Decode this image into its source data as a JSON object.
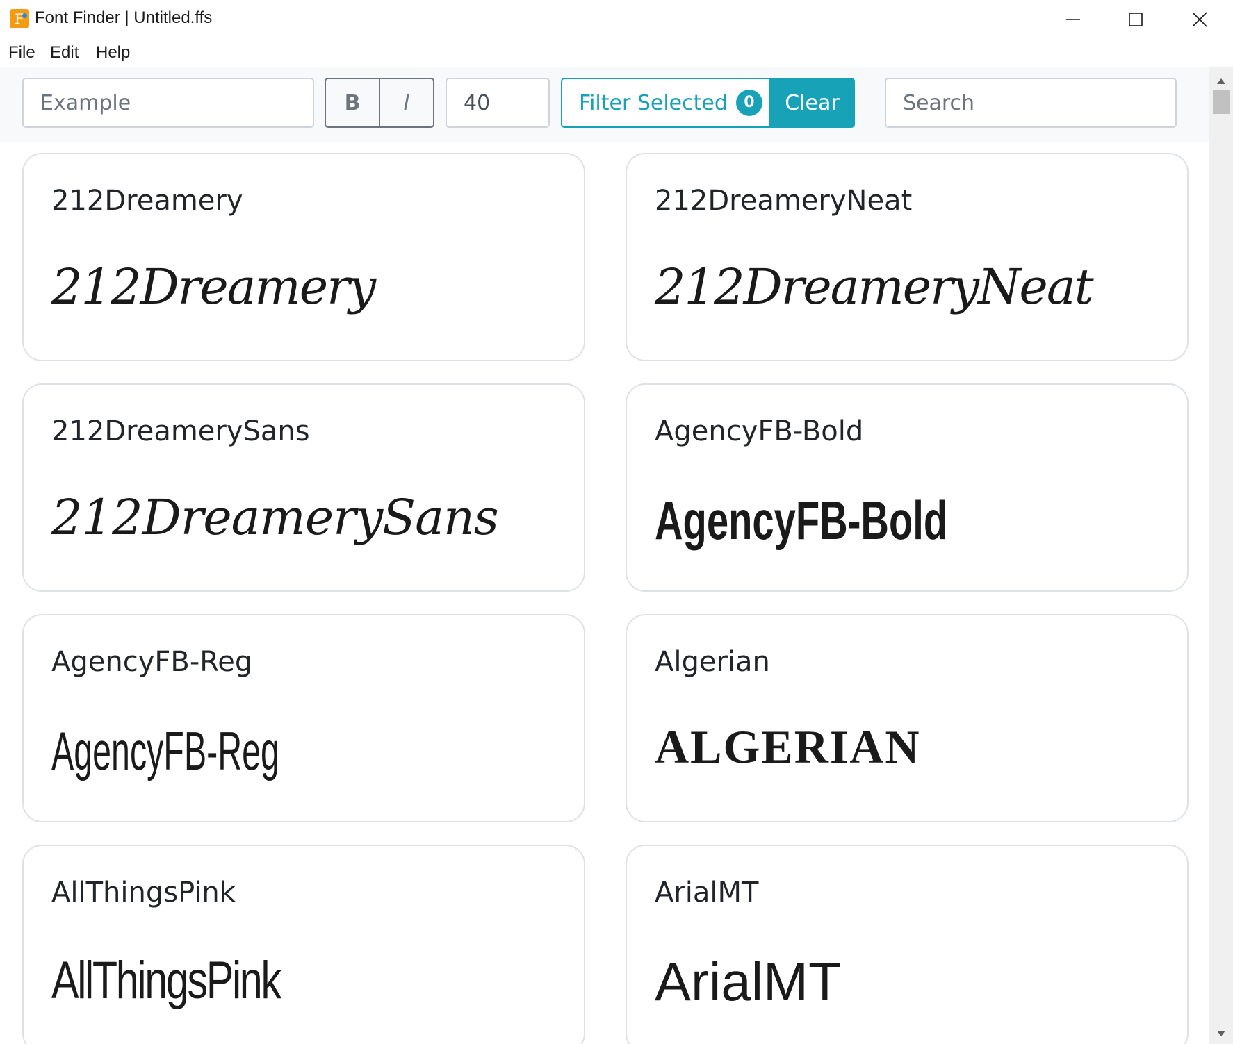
{
  "window": {
    "title": "Font Finder | Untitled.ffs",
    "app_icon_letter": "F"
  },
  "menu": {
    "items": [
      "File",
      "Edit",
      "Help"
    ]
  },
  "toolbar": {
    "example_placeholder": "Example",
    "bold_label": "B",
    "italic_label": "I",
    "font_size_value": "40",
    "filter_label": "Filter Selected",
    "filter_count": "0",
    "clear_label": "Clear",
    "search_placeholder": "Search",
    "accent_color": "#17a2b8"
  },
  "fonts": [
    {
      "name": "212Dreamery",
      "sample": "212Dreamery"
    },
    {
      "name": "212DreameryNeat",
      "sample": "212DreameryNeat"
    },
    {
      "name": "212DreamerySans",
      "sample": "212DreamerySans"
    },
    {
      "name": "AgencyFB-Bold",
      "sample": "AgencyFB-Bold"
    },
    {
      "name": "AgencyFB-Reg",
      "sample": "AgencyFB-Reg"
    },
    {
      "name": "Algerian",
      "sample": "ALGERIAN"
    },
    {
      "name": "AllThingsPink",
      "sample": "AllThingsPink"
    },
    {
      "name": "ArialMT",
      "sample": "ArialMT"
    }
  ]
}
